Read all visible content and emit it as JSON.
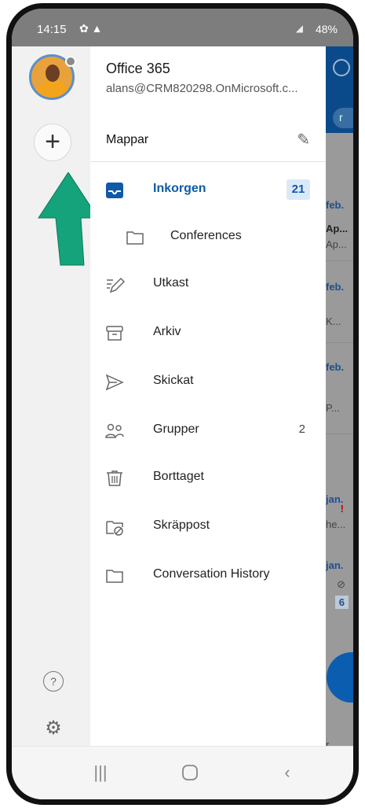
{
  "status_bar": {
    "time": "14:15",
    "battery": "48%"
  },
  "account": {
    "name": "Office 365",
    "email": "alans@CRM820298.OnMicrosoft.c..."
  },
  "folders_header": {
    "title": "Mappar"
  },
  "folders": [
    {
      "label": "Inkorgen",
      "badge": "21",
      "icon": "inbox-icon",
      "active": true
    },
    {
      "label": "Conferences",
      "icon": "folder-icon"
    },
    {
      "label": "Utkast",
      "icon": "drafts-icon"
    },
    {
      "label": "Arkiv",
      "icon": "archive-icon"
    },
    {
      "label": "Skickat",
      "icon": "sent-icon"
    },
    {
      "label": "Grupper",
      "count": "2",
      "icon": "groups-icon"
    },
    {
      "label": "Borttaget",
      "icon": "trash-icon"
    },
    {
      "label": "Skräppost",
      "icon": "junk-icon"
    },
    {
      "label": "Conversation History",
      "icon": "folder-icon"
    }
  ],
  "background_mail": {
    "partial_text": [
      "r",
      "feb.",
      "Ap...",
      "Ap...",
      "feb.",
      "K...",
      "feb.",
      "P...",
      "jan.",
      "!",
      "he...",
      "jan.",
      "6",
      "r"
    ]
  },
  "colors": {
    "accent": "#0f5aa8",
    "arrow": "#14a37a",
    "badge_bg": "#dbe9f7"
  }
}
